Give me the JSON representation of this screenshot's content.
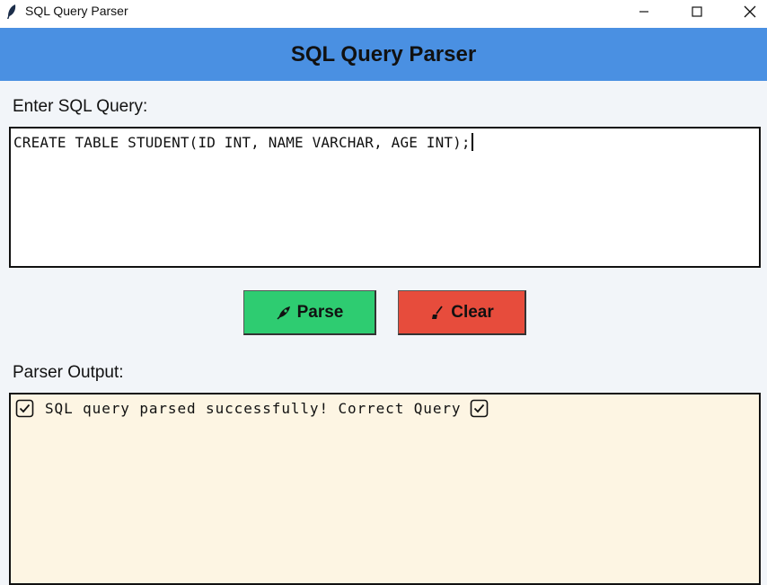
{
  "window": {
    "title": "SQL Query Parser",
    "icon": "feather-icon",
    "controls": [
      "minimize-icon",
      "maximize-icon",
      "close-icon"
    ]
  },
  "header": {
    "title": "SQL Query Parser",
    "background": "#4a90e2"
  },
  "query": {
    "label": "Enter SQL Query:",
    "value": "CREATE TABLE STUDENT(ID INT, NAME VARCHAR, AGE INT);"
  },
  "buttons": {
    "parse": {
      "label": "Parse",
      "icon": "rocket-icon",
      "color": "#2ecc71"
    },
    "clear": {
      "label": "Clear",
      "icon": "broom-icon",
      "color": "#e74c3c"
    }
  },
  "output": {
    "label": "Parser Output:",
    "message": "SQL query parsed successfully! Correct Query",
    "icon": "check-box-icon",
    "background": "#fdf5e3"
  }
}
